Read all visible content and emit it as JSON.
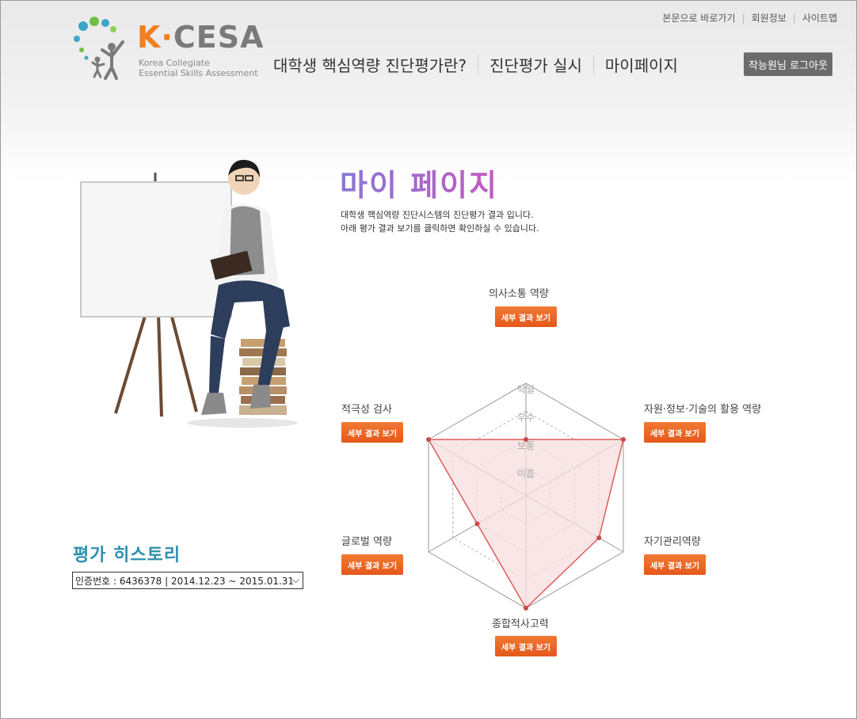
{
  "util_links": [
    "본문으로 바로가기",
    "회원정보",
    "사이트맵"
  ],
  "logo": {
    "brand_k": "K",
    "brand_dot": "·",
    "brand_cesa": "CESA",
    "sub_line1": "Korea Collegiate",
    "sub_line2": "Essential Skills Assessment"
  },
  "nav": [
    "대학생 핵심역량 진단평가란?",
    "진단평가 실시",
    "마이페이지"
  ],
  "logout_label": "작능원님 로그아웃",
  "page": {
    "title": "마이 페이지",
    "desc_line1": "대학생 핵심역량 진단시스템의 진단평가 결과 입니다.",
    "desc_line2": "아래 평가 결과 보기를 클릭하면 확인하실 수 있습니다."
  },
  "detail_button_label": "세부 결과 보기",
  "competencies": {
    "top": "의사소통 역량",
    "upper_right": "자원·정보·기술의 활용 역량",
    "lower_right": "자기관리역량",
    "bottom": "종합적사고력",
    "lower_left": "글로벌 역량",
    "upper_left": "적극성 검사"
  },
  "radar": {
    "levels": [
      "미흡",
      "보통",
      "우수",
      "탁월"
    ],
    "axes": [
      "의사소통 역량",
      "자원·정보·기술의 활용 역량",
      "자기관리역량",
      "종합적사고력",
      "글로벌 역량",
      "적극성 검사"
    ],
    "scores": [
      0.5,
      1.0,
      0.75,
      1.0,
      0.5,
      1.0
    ],
    "fill_color": "#f7dede",
    "line_color": "#e05a5a"
  },
  "history": {
    "title": "평가 히스토리",
    "selected": "인증번호 : 6436378 | 2014.12.23 ~ 2015.01.31"
  }
}
